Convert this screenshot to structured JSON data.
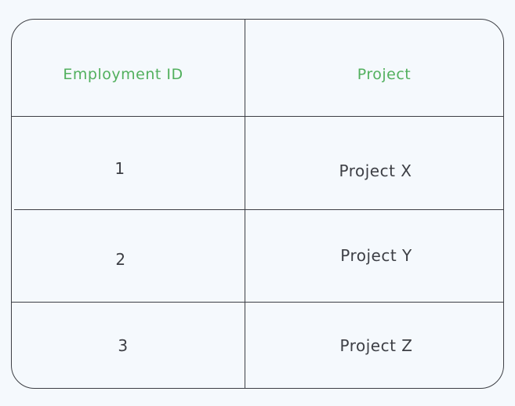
{
  "table": {
    "headers": [
      "Employment ID",
      "Project"
    ],
    "rows": [
      [
        "1",
        "Project X"
      ],
      [
        "2",
        "Project Y"
      ],
      [
        "3",
        "Project Z"
      ]
    ]
  },
  "colors": {
    "header_text": "#52b05e",
    "body_text": "#3d3f45",
    "lines": "#3d3f45",
    "background": "#f5f9fd"
  }
}
